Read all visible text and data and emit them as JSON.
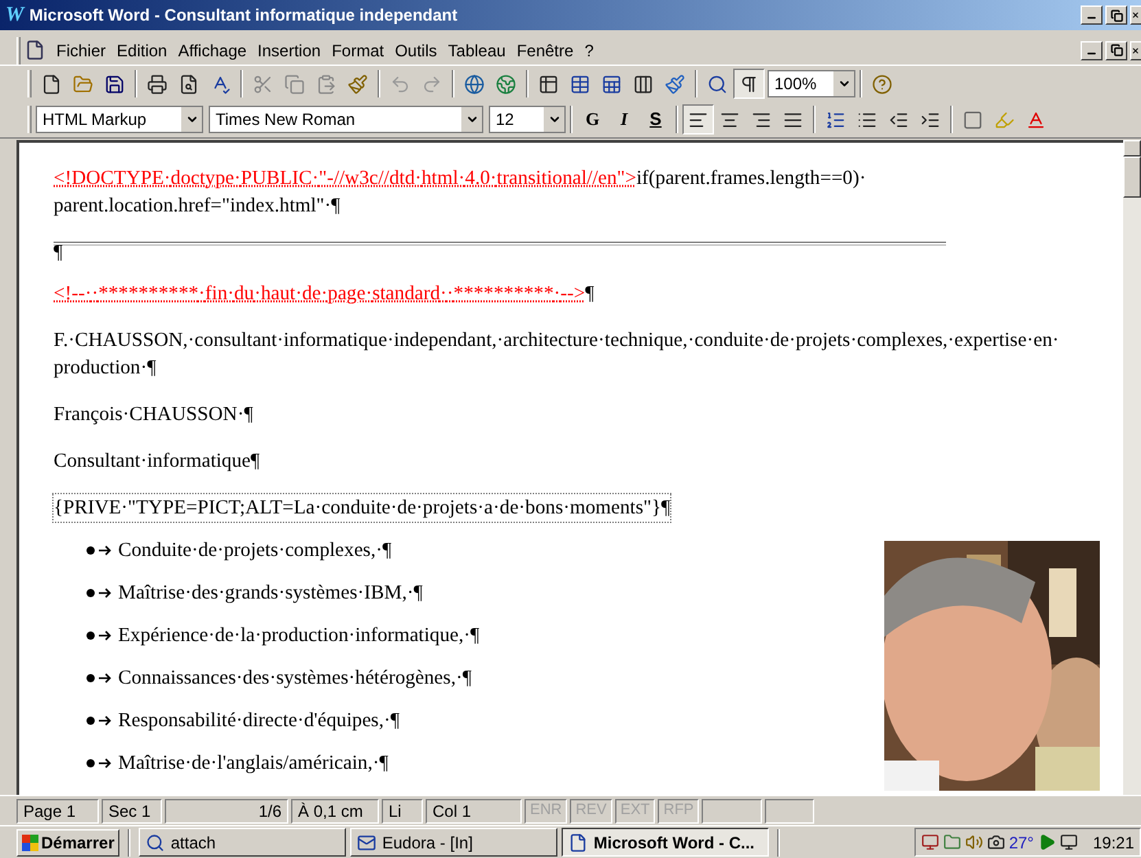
{
  "window": {
    "logo": "W",
    "title": "Microsoft Word - Consultant informatique independant"
  },
  "menu": [
    "Fichier",
    "Edition",
    "Affichage",
    "Insertion",
    "Format",
    "Outils",
    "Tableau",
    "Fenêtre",
    "?"
  ],
  "standard_toolbar": {
    "zoom": "100%",
    "show_marks_pressed": true
  },
  "format_toolbar": {
    "style": "HTML Markup",
    "font": "Times New Roman",
    "size": "12",
    "bold": "G",
    "italic": "I",
    "underline": "S",
    "alignment": [
      {
        "selected": true
      },
      {
        "selected": false
      },
      {
        "selected": false
      },
      {
        "selected": false
      }
    ]
  },
  "document": [
    {
      "kind": "code",
      "segments": [
        {
          "kind": "markup",
          "text": "<!DOCTYPE·doctype·PUBLIC·\"-//w3c//dtd·html·4.0·transitional//en\">"
        },
        {
          "kind": "text",
          "text": "if(parent.frames.length==0)·parent.location.href=\"index.html\"·¶"
        }
      ]
    },
    {
      "kind": "rule",
      "text": "¶"
    },
    {
      "kind": "code",
      "segments": [
        {
          "kind": "markup",
          "text": "<!--··**********·fin·du·haut·de·page·standard··**********·-->"
        },
        {
          "kind": "text",
          "text": "¶"
        }
      ]
    },
    {
      "kind": "para",
      "text": "F.·CHAUSSON,·consultant·informatique·independant,·architecture·technique,·conduite·de·projets·complexes,·expertise·en·production·¶"
    },
    {
      "kind": "para",
      "text": "François·CHAUSSON·¶"
    },
    {
      "kind": "para",
      "text": "Consultant·informatique¶"
    },
    {
      "kind": "field",
      "text": "{PRIVE·\"TYPE=PICT;ALT=La·conduite·de·projets·a·de·bons·moments\"}¶"
    },
    {
      "kind": "bullet",
      "text": "Conduite·de·projets·complexes,·¶"
    },
    {
      "kind": "bullet",
      "text": "Maîtrise·des·grands·systèmes·IBM,·¶"
    },
    {
      "kind": "bullet",
      "text": "Expérience·de·la·production·informatique,·¶"
    },
    {
      "kind": "bullet",
      "text": "Connaissances·des·systèmes·hétérogènes,·¶"
    },
    {
      "kind": "bullet",
      "text": "Responsabilité·directe·d'équipes,·¶"
    },
    {
      "kind": "bullet",
      "text": "Maîtrise·de·l'anglais/américain,·¶"
    }
  ],
  "status_bar": {
    "page": "Page 1",
    "section": "Sec 1",
    "pages": "1/6",
    "position": "À 0,1 cm",
    "line": "Li",
    "column": "Col 1",
    "modes": [
      {
        "label": "ENR",
        "disabled": true
      },
      {
        "label": "REV",
        "disabled": true
      },
      {
        "label": "EXT",
        "disabled": true
      },
      {
        "label": "RFP",
        "disabled": true
      }
    ]
  },
  "taskbar": {
    "start": "Démarrer",
    "tasks": [
      {
        "label": "attach",
        "selected": false
      },
      {
        "label": "Eudora - [In]",
        "selected": false
      },
      {
        "label": "Microsoft Word - C...",
        "selected": true
      }
    ],
    "temperature": "27°",
    "clock": "19:21"
  }
}
